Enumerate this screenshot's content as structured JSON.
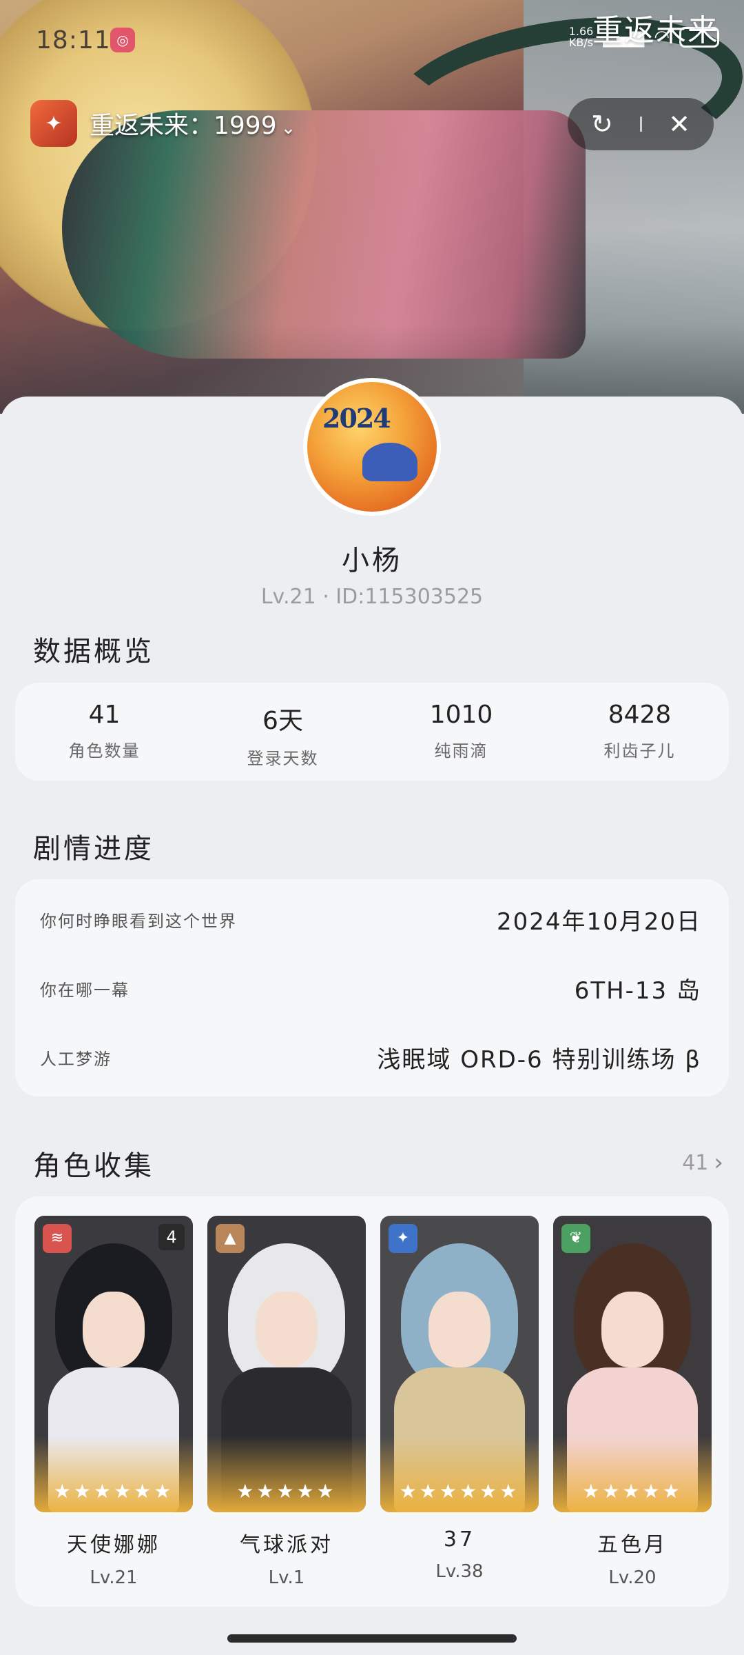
{
  "status_bar": {
    "time": "18:11",
    "net_speed": "1.66",
    "net_unit": "KB/s",
    "corner_title": "重返未来"
  },
  "app_bar": {
    "app_name": "重返未来：1999"
  },
  "profile": {
    "name": "小杨",
    "level_id": "Lv.21 · ID:115303525",
    "avatar_text": "2024"
  },
  "overview": {
    "title": "数据概览",
    "stats": [
      {
        "value": "41",
        "label": "角色数量"
      },
      {
        "value": "6天",
        "label": "登录天数"
      },
      {
        "value": "1010",
        "label": "纯雨滴"
      },
      {
        "value": "8428",
        "label": "利齿子儿"
      }
    ]
  },
  "story": {
    "title": "剧情进度",
    "rows": [
      {
        "key": "你何时睁眼看到这个世界",
        "value": "2024年10月20日"
      },
      {
        "key": "你在哪一幕",
        "value": "6TH-13  岛"
      },
      {
        "key": "人工梦游",
        "value": "浅眠域  ORD-6  特别训练场 β"
      }
    ]
  },
  "collection": {
    "title": "角色收集",
    "count": "41",
    "roles": [
      {
        "name": "天使娜娜",
        "level": "Lv.21",
        "tag": "4",
        "stars": "★★★★★★",
        "badge_color": "#d9534f",
        "hair": "#1b1b22",
        "outfit": "#e9e9ef"
      },
      {
        "name": "气球派对",
        "level": "Lv.1",
        "tag": "",
        "stars": "★★★★★",
        "badge_color": "#b9865a",
        "hair": "#e8e8ea",
        "outfit": "#2b2b2f"
      },
      {
        "name": "37",
        "level": "Lv.38",
        "tag": "",
        "stars": "★★★★★★",
        "badge_color": "#3f73c9",
        "hair": "#8fb1c8",
        "outfit": "#d8c59a"
      },
      {
        "name": "五色月",
        "level": "Lv.20",
        "tag": "",
        "stars": "★★★★★",
        "badge_color": "#4ca062",
        "hair": "#4a3024",
        "outfit": "#f2d3d2"
      }
    ]
  }
}
